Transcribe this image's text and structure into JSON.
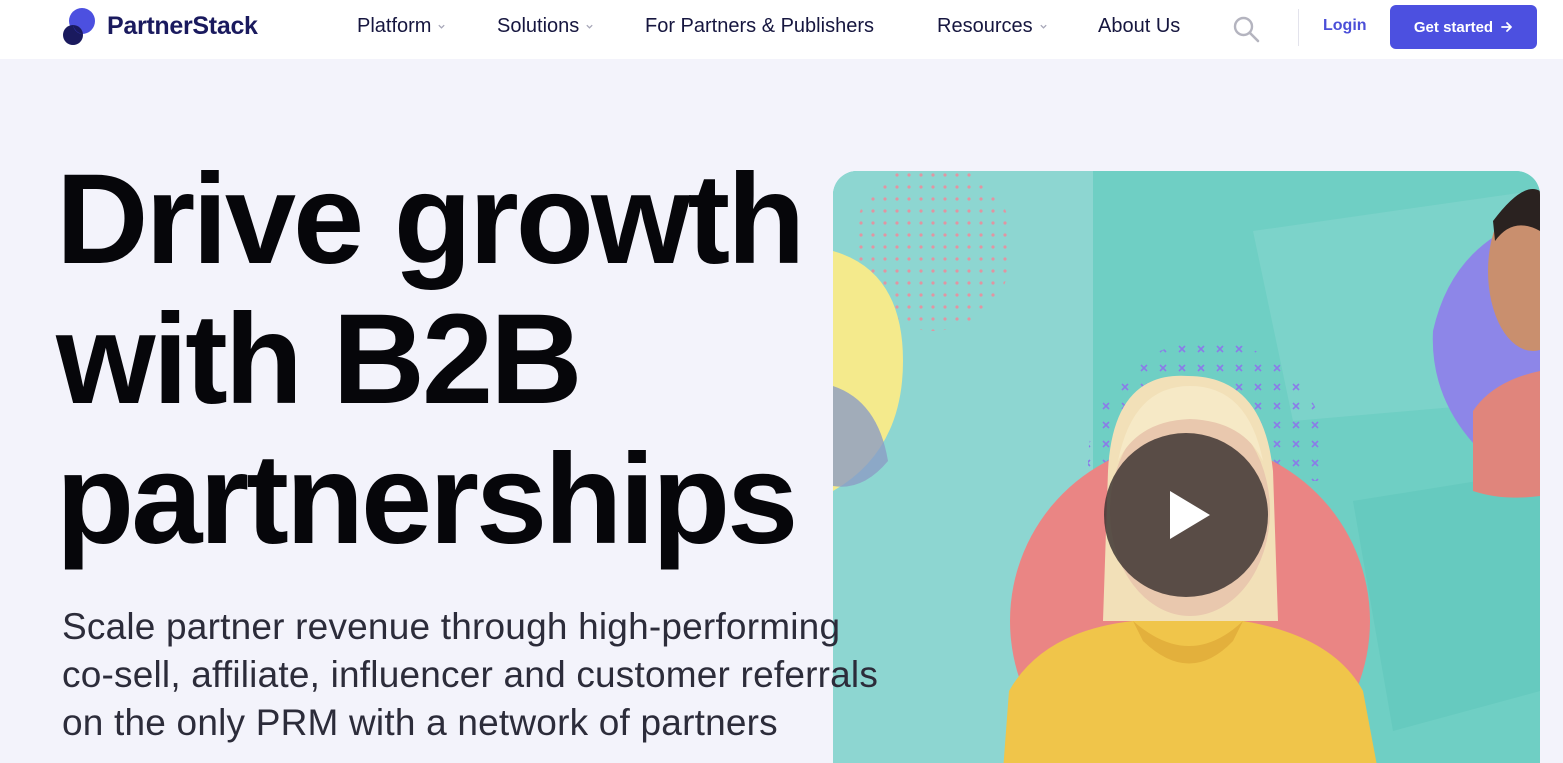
{
  "header": {
    "logo_text": "PartnerStack",
    "nav": [
      {
        "label": "Platform",
        "has_dropdown": true
      },
      {
        "label": "Solutions",
        "has_dropdown": true
      },
      {
        "label": "For Partners & Publishers",
        "has_dropdown": false
      },
      {
        "label": "Resources",
        "has_dropdown": true
      },
      {
        "label": "About Us",
        "has_dropdown": false
      }
    ],
    "search_icon": "search-icon",
    "login_label": "Login",
    "cta_label": "Get started",
    "cta_icon": "arrow-right-icon"
  },
  "hero": {
    "title_lines": [
      "Drive growth",
      "with B2B",
      "partnerships"
    ],
    "subtitle_lines": [
      "Scale partner revenue through high-performing",
      "co-sell, affiliate, influencer and customer referrals",
      "on the only PRM with a network of partners"
    ],
    "video_play_icon": "play-icon"
  },
  "colors": {
    "brand_navy": "#1a1a5e",
    "accent": "#4c50e0",
    "page_bg": "#f3f3fb",
    "video_teal": "#6fcfc4"
  }
}
